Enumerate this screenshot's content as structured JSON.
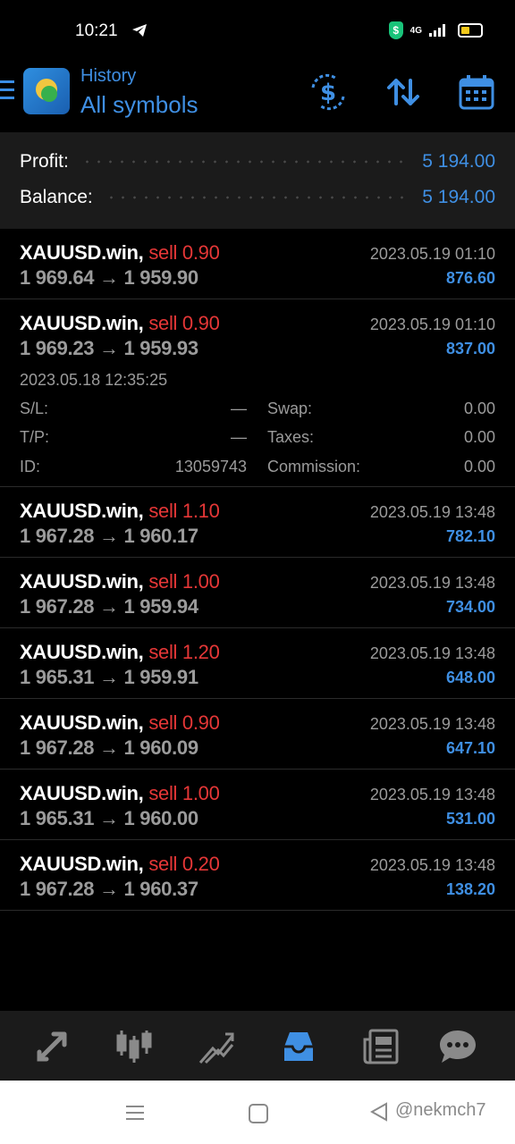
{
  "status_bar": {
    "time": "10:21",
    "network": "4G"
  },
  "header": {
    "subtitle": "History",
    "title": "All symbols"
  },
  "summary": {
    "profit_label": "Profit:",
    "profit_value": "5 194.00",
    "balance_label": "Balance:",
    "balance_value": "5 194.00"
  },
  "trades": [
    {
      "symbol": "XAUUSD.win,",
      "side": "sell 0.90",
      "prices": "1 969.64 → 1 959.90",
      "date": "2023.05.19 01:10",
      "profit": "876.60"
    },
    {
      "symbol": "XAUUSD.win,",
      "side": "sell 0.90",
      "prices": "1 969.23 → 1 959.93",
      "date": "2023.05.19 01:10",
      "profit": "837.00",
      "details": {
        "open_time": "2023.05.18 12:35:25",
        "sl_label": "S/L:",
        "sl_value": "—",
        "tp_label": "T/P:",
        "tp_value": "—",
        "id_label": "ID:",
        "id_value": "13059743",
        "swap_label": "Swap:",
        "swap_value": "0.00",
        "taxes_label": "Taxes:",
        "taxes_value": "0.00",
        "commission_label": "Commission:",
        "commission_value": "0.00"
      }
    },
    {
      "symbol": "XAUUSD.win,",
      "side": "sell 1.10",
      "prices": "1 967.28 → 1 960.17",
      "date": "2023.05.19 13:48",
      "profit": "782.10"
    },
    {
      "symbol": "XAUUSD.win,",
      "side": "sell 1.00",
      "prices": "1 967.28 → 1 959.94",
      "date": "2023.05.19 13:48",
      "profit": "734.00"
    },
    {
      "symbol": "XAUUSD.win,",
      "side": "sell 1.20",
      "prices": "1 965.31 → 1 959.91",
      "date": "2023.05.19 13:48",
      "profit": "648.00"
    },
    {
      "symbol": "XAUUSD.win,",
      "side": "sell 0.90",
      "prices": "1 967.28 → 1 960.09",
      "date": "2023.05.19 13:48",
      "profit": "647.10"
    },
    {
      "symbol": "XAUUSD.win,",
      "side": "sell 1.00",
      "prices": "1 965.31 → 1 960.00",
      "date": "2023.05.19 13:48",
      "profit": "531.00"
    },
    {
      "symbol": "XAUUSD.win,",
      "side": "sell 0.20",
      "prices": "1 967.28 → 1 960.37",
      "date": "2023.05.19 13:48",
      "profit": "138.20"
    }
  ],
  "bottom_nav": [
    {
      "icon": "quotes-icon"
    },
    {
      "icon": "chart-icon"
    },
    {
      "icon": "trade-icon"
    },
    {
      "icon": "history-icon",
      "active": true
    },
    {
      "icon": "news-icon"
    },
    {
      "icon": "messages-icon"
    }
  ],
  "watermark": "@nekmch7",
  "colors": {
    "accent": "#3f8fe3",
    "sell": "#e53737",
    "muted": "#9b9b9b",
    "panel": "#1b1b1b"
  }
}
